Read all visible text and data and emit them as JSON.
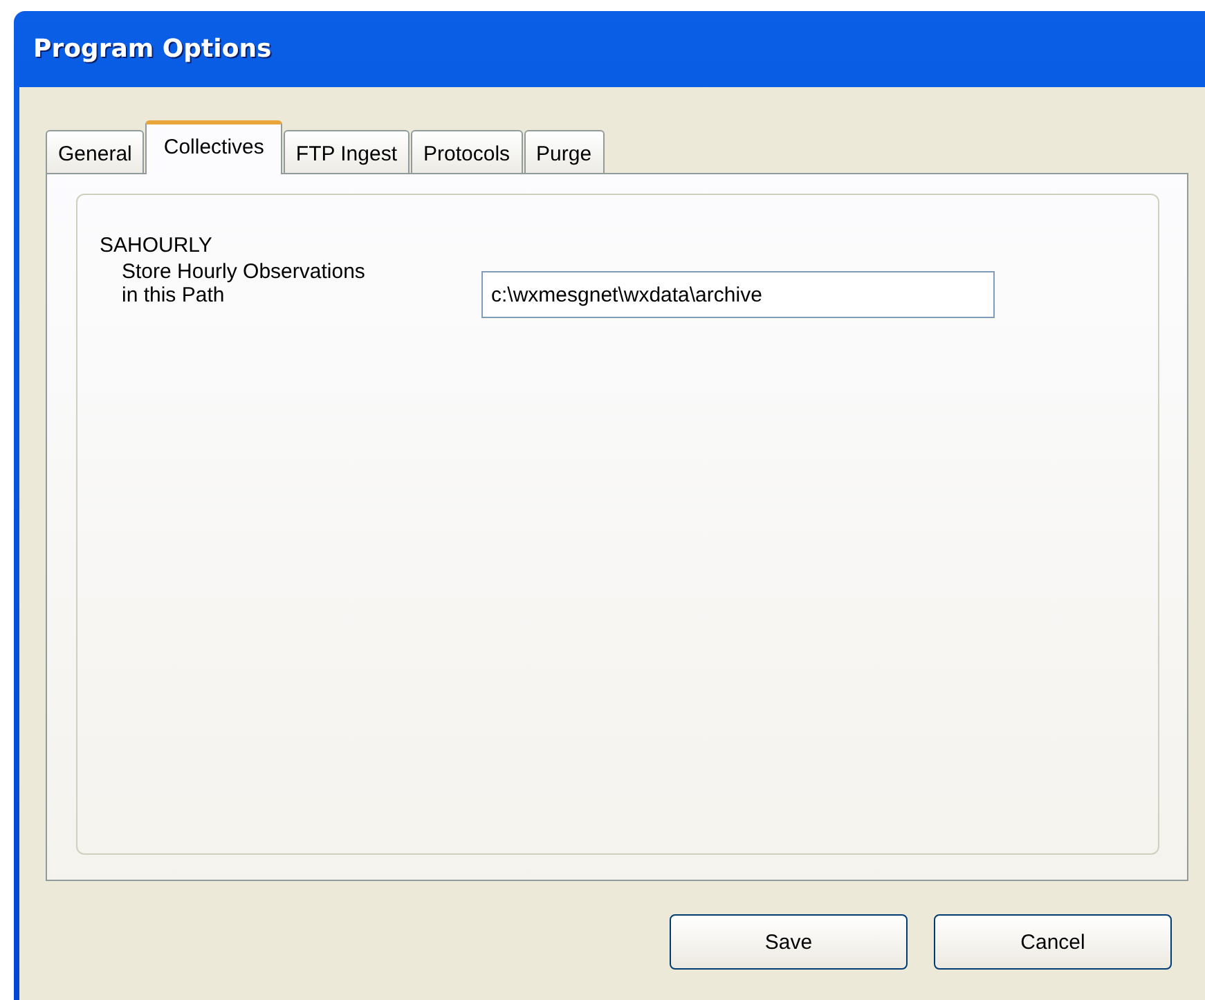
{
  "window": {
    "title": "Program Options"
  },
  "tabs": [
    {
      "label": "General",
      "selected": false
    },
    {
      "label": "Collectives",
      "selected": true
    },
    {
      "label": "FTP Ingest",
      "selected": false
    },
    {
      "label": "Protocols",
      "selected": false
    },
    {
      "label": "Purge",
      "selected": false
    }
  ],
  "section": {
    "heading": "SAHOURLY",
    "field_label": "Store Hourly Observations in this Path",
    "value": "c:\\wxmesgnet\\wxdata\\archive"
  },
  "buttons": [
    "Save",
    "Cancel"
  ]
}
